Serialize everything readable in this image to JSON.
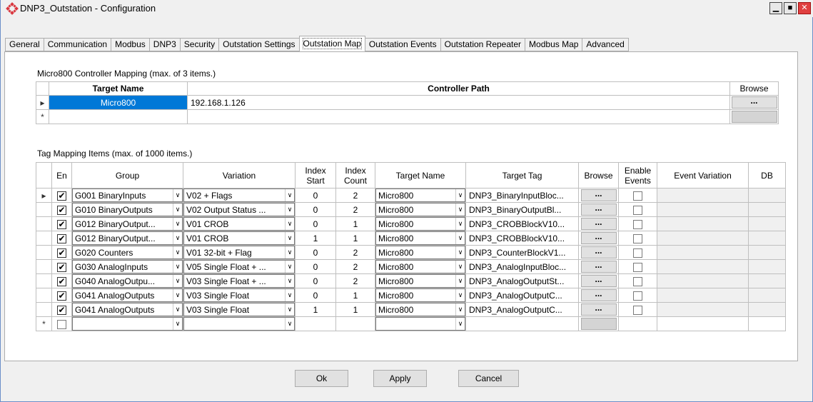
{
  "window": {
    "title": "DNP3_Outstation - Configuration",
    "accent_color": "#0078d7"
  },
  "tabs": [
    {
      "label": "General"
    },
    {
      "label": "Communication"
    },
    {
      "label": "Modbus"
    },
    {
      "label": "DNP3"
    },
    {
      "label": "Security"
    },
    {
      "label": "Outstation Settings"
    },
    {
      "label": "Outstation Map"
    },
    {
      "label": "Outstation Events"
    },
    {
      "label": "Outstation Repeater"
    },
    {
      "label": "Modbus Map"
    },
    {
      "label": "Advanced"
    }
  ],
  "controller_mapping": {
    "label": "Micro800 Controller Mapping (max. of 3 items.)",
    "headers": {
      "target_name": "Target Name",
      "controller_path": "Controller Path",
      "browse": "Browse"
    },
    "rows": [
      {
        "marker": "▸",
        "target_name": "Micro800",
        "controller_path": "192.168.1.126",
        "browse": "..."
      }
    ],
    "new_row_marker": "*"
  },
  "tag_mapping": {
    "label": "Tag Mapping Items (max. of 1000 items.)",
    "headers": {
      "en": "En",
      "group": "Group",
      "variation": "Variation",
      "index_start": "Index Start",
      "index_count": "Index Count",
      "target_name": "Target Name",
      "target_tag": "Target Tag",
      "browse": "Browse",
      "enable_events": "Enable Events",
      "event_variation": "Event Variation",
      "db": "DB"
    },
    "rows": [
      {
        "marker": "▸",
        "en": true,
        "group": "G001 BinaryInputs",
        "variation": "V02 + Flags",
        "index_start": "0",
        "index_count": "2",
        "target_name": "Micro800",
        "target_tag": "DNP3_BinaryInputBloc...",
        "browse": "...",
        "enable_events": false
      },
      {
        "marker": "",
        "en": true,
        "group": "G010 BinaryOutputs",
        "variation": "V02 Output Status ...",
        "index_start": "0",
        "index_count": "2",
        "target_name": "Micro800",
        "target_tag": "DNP3_BinaryOutputBl...",
        "browse": "...",
        "enable_events": false
      },
      {
        "marker": "",
        "en": true,
        "group": "G012 BinaryOutput...",
        "variation": "V01 CROB",
        "index_start": "0",
        "index_count": "1",
        "target_name": "Micro800",
        "target_tag": "DNP3_CROBBlockV10...",
        "browse": "...",
        "enable_events": false
      },
      {
        "marker": "",
        "en": true,
        "group": "G012 BinaryOutput...",
        "variation": "V01 CROB",
        "index_start": "1",
        "index_count": "1",
        "target_name": "Micro800",
        "target_tag": "DNP3_CROBBlockV10...",
        "browse": "...",
        "enable_events": false
      },
      {
        "marker": "",
        "en": true,
        "group": "G020 Counters",
        "variation": "V01 32-bit + Flag",
        "index_start": "0",
        "index_count": "2",
        "target_name": "Micro800",
        "target_tag": "DNP3_CounterBlockV1...",
        "browse": "...",
        "enable_events": false
      },
      {
        "marker": "",
        "en": true,
        "group": "G030 AnalogInputs",
        "variation": "V05 Single Float + ...",
        "index_start": "0",
        "index_count": "2",
        "target_name": "Micro800",
        "target_tag": "DNP3_AnalogInputBloc...",
        "browse": "...",
        "enable_events": false
      },
      {
        "marker": "",
        "en": true,
        "group": "G040 AnalogOutpu...",
        "variation": "V03 Single Float + ...",
        "index_start": "0",
        "index_count": "2",
        "target_name": "Micro800",
        "target_tag": "DNP3_AnalogOutputSt...",
        "browse": "...",
        "enable_events": false
      },
      {
        "marker": "",
        "en": true,
        "group": "G041 AnalogOutputs",
        "variation": "V03 Single Float",
        "index_start": "0",
        "index_count": "1",
        "target_name": "Micro800",
        "target_tag": "DNP3_AnalogOutputC...",
        "browse": "...",
        "enable_events": false
      },
      {
        "marker": "",
        "en": true,
        "group": "G041 AnalogOutputs",
        "variation": "V03 Single Float",
        "index_start": "1",
        "index_count": "1",
        "target_name": "Micro800",
        "target_tag": "DNP3_AnalogOutputC...",
        "browse": "...",
        "enable_events": false
      }
    ],
    "new_row_marker": "*"
  },
  "buttons": {
    "ok": "Ok",
    "apply": "Apply",
    "cancel": "Cancel"
  },
  "icons": {
    "dropdown": "chevron-down-icon",
    "check": "check-icon"
  }
}
